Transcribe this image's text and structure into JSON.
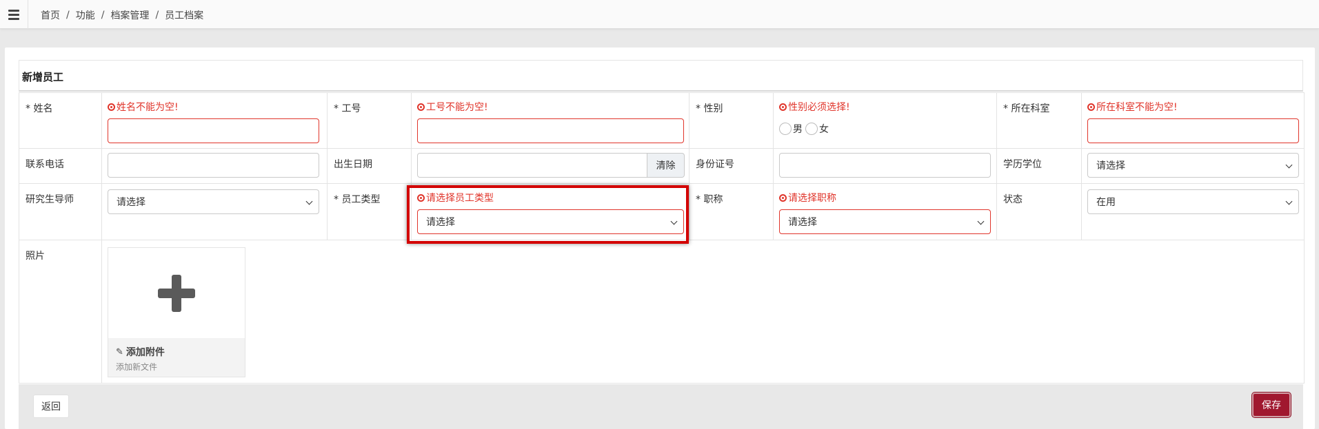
{
  "breadcrumb": [
    "首页",
    "功能",
    "档案管理",
    "员工档案"
  ],
  "breadcrumb_separator": "/",
  "card": {
    "title": "新增员工"
  },
  "form": {
    "name": {
      "label": "* 姓名",
      "error": "姓名不能为空!",
      "value": ""
    },
    "emp_no": {
      "label": "* 工号",
      "error": "工号不能为空!",
      "value": ""
    },
    "gender": {
      "label": "* 性别",
      "error": "性别必须选择!",
      "options": [
        "男",
        "女"
      ]
    },
    "department": {
      "label": "* 所在科室",
      "error": "所在科室不能为空!",
      "value": ""
    },
    "phone": {
      "label": "联系电话",
      "value": ""
    },
    "birth_date": {
      "label": "出生日期",
      "value": "",
      "clear_label": "清除"
    },
    "id_card": {
      "label": "身份证号",
      "value": ""
    },
    "degree": {
      "label": "学历学位",
      "selected": "请选择"
    },
    "advisor": {
      "label": "研究生导师",
      "selected": "请选择"
    },
    "emp_type": {
      "label": "* 员工类型",
      "error": "请选择员工类型",
      "selected": "请选择"
    },
    "title": {
      "label": "* 职称",
      "error": "请选择职称",
      "selected": "请选择"
    },
    "status": {
      "label": "状态",
      "selected": "在用"
    },
    "photo": {
      "label": "照片",
      "add_label": "添加附件",
      "add_hint": "添加新文件"
    }
  },
  "footer": {
    "back_label": "返回",
    "save_label": "保存"
  },
  "colors": {
    "error": "#e0342a",
    "save_button": "#a0182f",
    "highlight": "#d30000"
  },
  "icons": {
    "menu": "hamburger-icon",
    "upload": "plus-icon",
    "attachment": "paperclip-icon"
  }
}
